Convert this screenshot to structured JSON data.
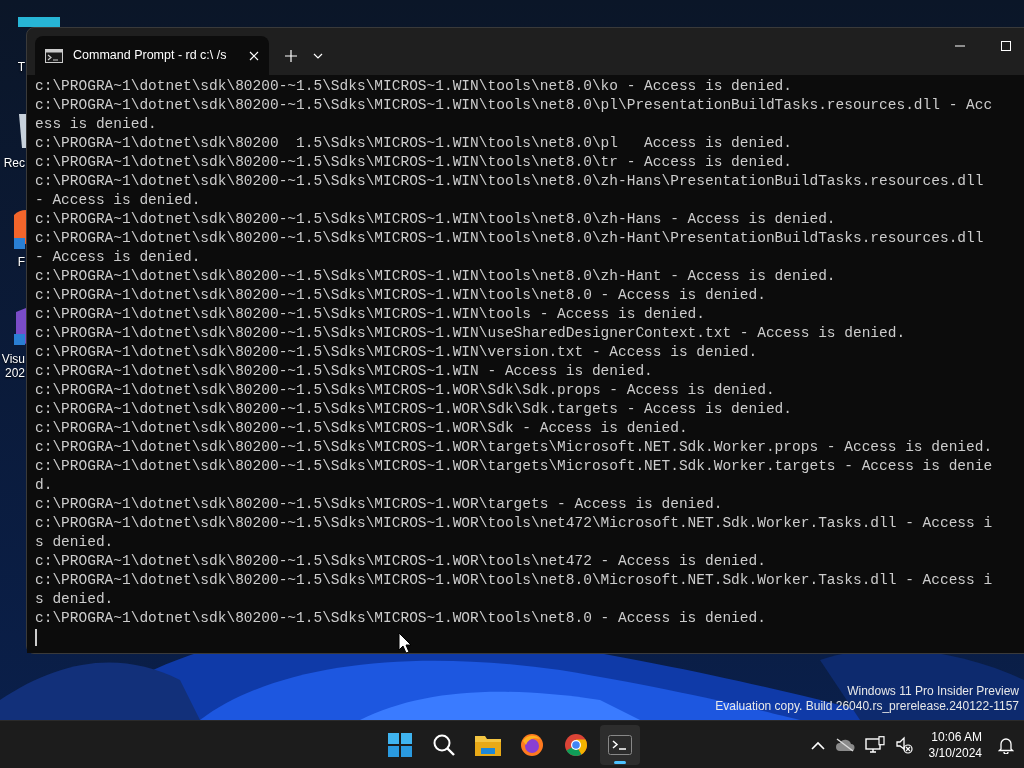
{
  "desktop_icons": [
    {
      "kind": "tile",
      "lines": [
        "T"
      ]
    },
    {
      "kind": "bin",
      "lines": [
        "Rec"
      ]
    },
    {
      "kind": "browser",
      "lines": [
        "F"
      ]
    },
    {
      "kind": "ide",
      "lines": [
        "Visu",
        "202"
      ]
    }
  ],
  "window": {
    "tabs": [
      {
        "label": "Command Prompt - rd  c:\\ /s",
        "selected": true
      }
    ],
    "terminal": {
      "lines": [
        "c:\\PROGRA~1\\dotnet\\sdk\\80200-~1.5\\Sdks\\MICROS~1.WIN\\tools\\net8.0\\ko - Access is denied.",
        "c:\\PROGRA~1\\dotnet\\sdk\\80200-~1.5\\Sdks\\MICROS~1.WIN\\tools\\net8.0\\pl\\PresentationBuildTasks.resources.dll - Acc",
        "ess is denied.",
        "c:\\PROGRA~1\\dotnet\\sdk\\80200  1.5\\Sdks\\MICROS~1.WIN\\tools\\net8.0\\pl   Access is denied.",
        "c:\\PROGRA~1\\dotnet\\sdk\\80200-~1.5\\Sdks\\MICROS~1.WIN\\tools\\net8.0\\tr - Access is denied.",
        "c:\\PROGRA~1\\dotnet\\sdk\\80200-~1.5\\Sdks\\MICROS~1.WIN\\tools\\net8.0\\zh-Hans\\PresentationBuildTasks.resources.dll",
        "- Access is denied.",
        "c:\\PROGRA~1\\dotnet\\sdk\\80200-~1.5\\Sdks\\MICROS~1.WIN\\tools\\net8.0\\zh-Hans - Access is denied.",
        "c:\\PROGRA~1\\dotnet\\sdk\\80200-~1.5\\Sdks\\MICROS~1.WIN\\tools\\net8.0\\zh-Hant\\PresentationBuildTasks.resources.dll",
        "- Access is denied.",
        "c:\\PROGRA~1\\dotnet\\sdk\\80200-~1.5\\Sdks\\MICROS~1.WIN\\tools\\net8.0\\zh-Hant - Access is denied.",
        "c:\\PROGRA~1\\dotnet\\sdk\\80200-~1.5\\Sdks\\MICROS~1.WIN\\tools\\net8.0 - Access is denied.",
        "c:\\PROGRA~1\\dotnet\\sdk\\80200-~1.5\\Sdks\\MICROS~1.WIN\\tools - Access is denied.",
        "c:\\PROGRA~1\\dotnet\\sdk\\80200-~1.5\\Sdks\\MICROS~1.WIN\\useSharedDesignerContext.txt - Access is denied.",
        "c:\\PROGRA~1\\dotnet\\sdk\\80200-~1.5\\Sdks\\MICROS~1.WIN\\version.txt - Access is denied.",
        "c:\\PROGRA~1\\dotnet\\sdk\\80200-~1.5\\Sdks\\MICROS~1.WIN - Access is denied.",
        "c:\\PROGRA~1\\dotnet\\sdk\\80200-~1.5\\Sdks\\MICROS~1.WOR\\Sdk\\Sdk.props - Access is denied.",
        "c:\\PROGRA~1\\dotnet\\sdk\\80200-~1.5\\Sdks\\MICROS~1.WOR\\Sdk\\Sdk.targets - Access is denied.",
        "c:\\PROGRA~1\\dotnet\\sdk\\80200-~1.5\\Sdks\\MICROS~1.WOR\\Sdk - Access is denied.",
        "c:\\PROGRA~1\\dotnet\\sdk\\80200-~1.5\\Sdks\\MICROS~1.WOR\\targets\\Microsoft.NET.Sdk.Worker.props - Access is denied.",
        "c:\\PROGRA~1\\dotnet\\sdk\\80200-~1.5\\Sdks\\MICROS~1.WOR\\targets\\Microsoft.NET.Sdk.Worker.targets - Access is denie",
        "d.",
        "c:\\PROGRA~1\\dotnet\\sdk\\80200-~1.5\\Sdks\\MICROS~1.WOR\\targets - Access is denied.",
        "c:\\PROGRA~1\\dotnet\\sdk\\80200-~1.5\\Sdks\\MICROS~1.WOR\\tools\\net472\\Microsoft.NET.Sdk.Worker.Tasks.dll - Access i",
        "s denied.",
        "c:\\PROGRA~1\\dotnet\\sdk\\80200-~1.5\\Sdks\\MICROS~1.WOR\\tools\\net472 - Access is denied.",
        "c:\\PROGRA~1\\dotnet\\sdk\\80200-~1.5\\Sdks\\MICROS~1.WOR\\tools\\net8.0\\Microsoft.NET.Sdk.Worker.Tasks.dll - Access i",
        "s denied.",
        "c:\\PROGRA~1\\dotnet\\sdk\\80200-~1.5\\Sdks\\MICROS~1.WOR\\tools\\net8.0 - Access is denied."
      ]
    }
  },
  "watermark": [
    "Windows 11 Pro Insider Preview",
    "Evaluation copy. Build 26040.rs_prerelease.240122-1157"
  ],
  "taskbar": {
    "apps": [
      {
        "kind": "start",
        "selected": false
      },
      {
        "kind": "search",
        "selected": false
      },
      {
        "kind": "folder",
        "selected": false
      },
      {
        "kind": "firefox",
        "selected": false
      },
      {
        "kind": "chrome",
        "selected": false
      },
      {
        "kind": "terminal",
        "selected": true
      }
    ],
    "clock": {
      "time": "10:06 AM",
      "date": "3/10/2024"
    }
  }
}
